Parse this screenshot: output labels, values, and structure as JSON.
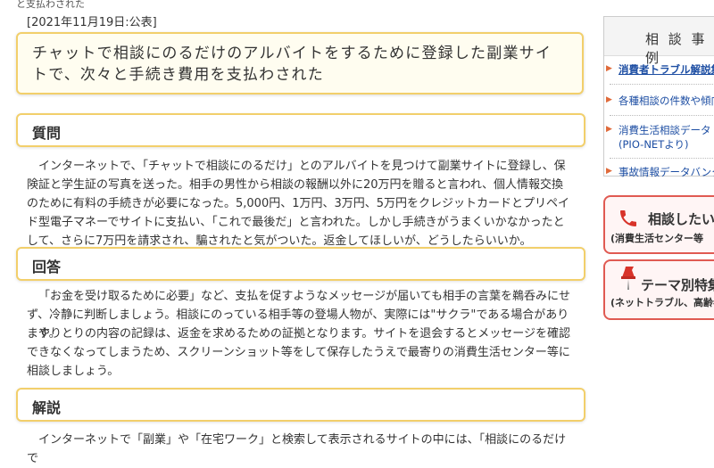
{
  "page": {
    "top_fragment": "と支払わされた",
    "date": "[2021年11月19日:公表]",
    "title": "チャットで相談にのるだけのアルバイトをするために登録した副業サイトで、次々と手続き費用を支払わされた"
  },
  "sections": {
    "question": {
      "heading": "質問",
      "body": "インターネットで、「チャットで相談にのるだけ」とのアルバイトを見つけて副業サイトに登録し、保険証と学生証の写真を送った。相手の男性から相談の報酬以外に20万円を贈ると言われ、個人情報交換のために有料の手続きが必要になった。5,000円、1万円、3万円、5万円をクレジットカードとプリペイド型電子マネーでサイトに支払い、「これで最後だ」と言われた。しかし手続きがうまくいかなかったとして、さらに7万円を請求され、騙されたと気がついた。返金してほしいが、どうしたらいいか。"
    },
    "answer": {
      "heading": "回答",
      "body1": "「お金を受け取るために必要」など、支払を促すようなメッセージが届いても相手の言葉を鵜呑みにせず、冷静に判断しましょう。相談にのっている相手等の登場人物が、実際には\"サクラ\"である場合があります。",
      "body2": "やりとりの内容の記録は、返金を求めるための証拠となります。サイトを退会するとメッセージを確認できなくなってしまうため、スクリーンショット等をして保存したうえで最寄りの消費生活センター等に相談しましょう。"
    },
    "explanation": {
      "heading": "解説",
      "body": "インターネットで「副業」や「在宅ワーク」と検索して表示されるサイトの中には、「相談にのるだけで"
    }
  },
  "sidebar": {
    "case_header": "相 談 事 例",
    "links": [
      {
        "label": "消費者トラブル解説集",
        "bold": true
      },
      {
        "label": "各種相談の件数や傾向",
        "bold": false
      },
      {
        "label": "消費生活相談データベース(PIO-NETより)",
        "line1": "消費生活相談データ",
        "line2": "(PIO-NETより)",
        "bold": false
      },
      {
        "label": "事故情報データバンク",
        "bold": false
      }
    ],
    "consult_banner": {
      "title": "相談したい",
      "subtitle": "(消費生活センター等"
    },
    "theme_banner": {
      "title": "テーマ別特集",
      "subtitle": "(ネットトラブル、高齢者"
    }
  },
  "colors": {
    "accent_border": "#f2cf6b",
    "link": "#1d4ea3",
    "banner_red": "#e05a52"
  }
}
